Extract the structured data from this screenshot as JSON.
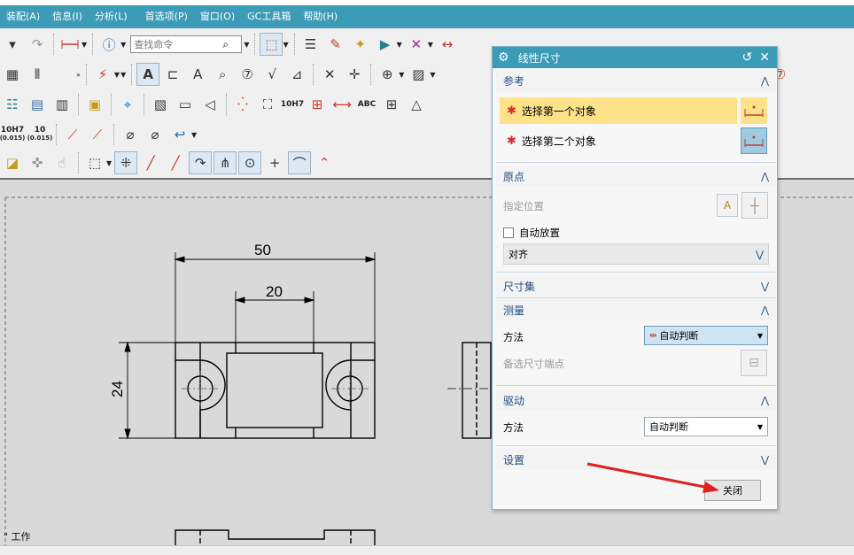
{
  "menu": [
    "装配(A)",
    "信息(I)",
    "分析(L)",
    "首选项(P)",
    "窗口(O)",
    "GC工具箱",
    "帮助(H)"
  ],
  "toolbar": {
    "find_placeholder": "查找命令",
    "tol_1_top": "10H7",
    "tol_1_bottom": "(0.015)",
    "tol_2_top": "10",
    "tol_2_bottom": "(0.015)",
    "h7_label": "10H7",
    "abc_label": "ABC"
  },
  "drawing": {
    "dim_50": "50",
    "dim_20": "20",
    "dim_24": "24"
  },
  "work_label": "\" 工作",
  "dialog": {
    "title": "线性尺寸",
    "sections": {
      "reference": {
        "title": "参考",
        "select_first": "选择第一个对象",
        "select_second": "选择第二个对象"
      },
      "origin": {
        "title": "原点",
        "specify_position": "指定位置",
        "auto_place": "自动放置",
        "align_value": "对齐"
      },
      "dim_set": {
        "title": "尺寸集"
      },
      "measure": {
        "title": "测量",
        "method_label": "方法",
        "method_value": "自动判断",
        "alt_point": "备选尺寸端点"
      },
      "drive": {
        "title": "驱动",
        "method_label": "方法",
        "method_value": "自动判断"
      },
      "settings": {
        "title": "设置"
      }
    },
    "close": "关闭"
  },
  "colors": {
    "titlebar": "#3c9cb7",
    "highlight_row": "#fde28a",
    "section_text": "#1f4e86",
    "required_star": "#d42a2a",
    "arrow": "#e02020"
  }
}
